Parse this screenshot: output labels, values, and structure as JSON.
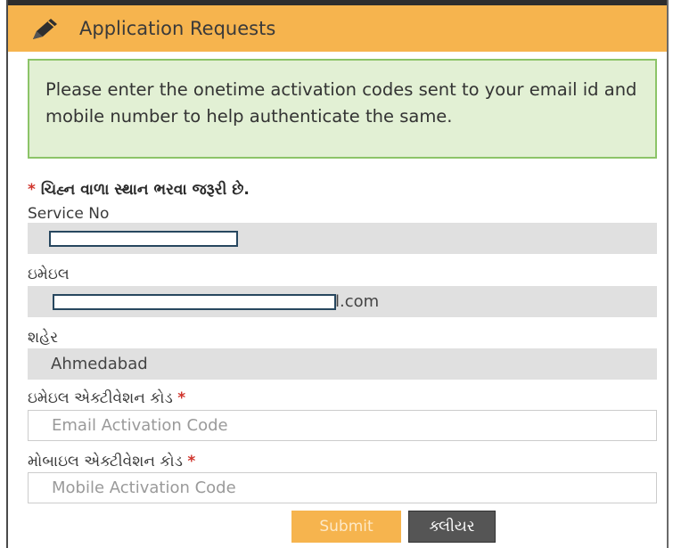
{
  "header": {
    "title": "Application Requests",
    "icon": "pencil-icon"
  },
  "notice": {
    "text": "Please enter the onetime activation codes sent to your email id and mobile number to help authenticate the same."
  },
  "required_note": {
    "star": "*",
    "text": "ચિહ્ન વાળા સ્થાન ભરવા જરૂરી છે."
  },
  "fields": {
    "service_no": {
      "label": "Service No",
      "value": ""
    },
    "email": {
      "label": "ઇમેઇલ",
      "value_suffix": "l.com"
    },
    "city": {
      "label": "શહેર",
      "value": "Ahmedabad"
    },
    "email_code": {
      "label": "ઇમેઇલ એક્ટીવેશન કોડ",
      "placeholder": "Email Activation Code",
      "required_mark": "*"
    },
    "mobile_code": {
      "label": "મોબાઇલ એક્ટીવેશન કોડ",
      "placeholder": "Mobile Activation Code",
      "required_mark": "*"
    }
  },
  "buttons": {
    "submit": "Submit",
    "clear": "ક્લીયર"
  },
  "colors": {
    "header_bg": "#f6b44e",
    "notice_bg": "#e2f0d4",
    "notice_border": "#8cc468",
    "required": "#d0342c",
    "clear_bg": "#555555"
  }
}
